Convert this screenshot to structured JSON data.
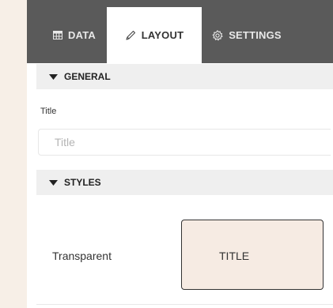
{
  "tabs": {
    "data": {
      "label": "DATA",
      "icon": "table-grid-icon"
    },
    "layout": {
      "label": "LAYOUT",
      "icon": "pencil-icon"
    },
    "settings": {
      "label": "SETTINGS",
      "icon": "gear-icon"
    }
  },
  "general": {
    "header": "GENERAL",
    "title_field": {
      "label": "Title",
      "value": "",
      "placeholder": "Title"
    }
  },
  "styles": {
    "header": "STYLES",
    "option": {
      "label": "Transparent",
      "preview_text": "TITLE"
    }
  },
  "colors": {
    "tab_bar": "#5a5a5a",
    "section_header": "#efefef",
    "swatch_fill": "#f6ebe3",
    "left_strip": "#f7efe7"
  }
}
